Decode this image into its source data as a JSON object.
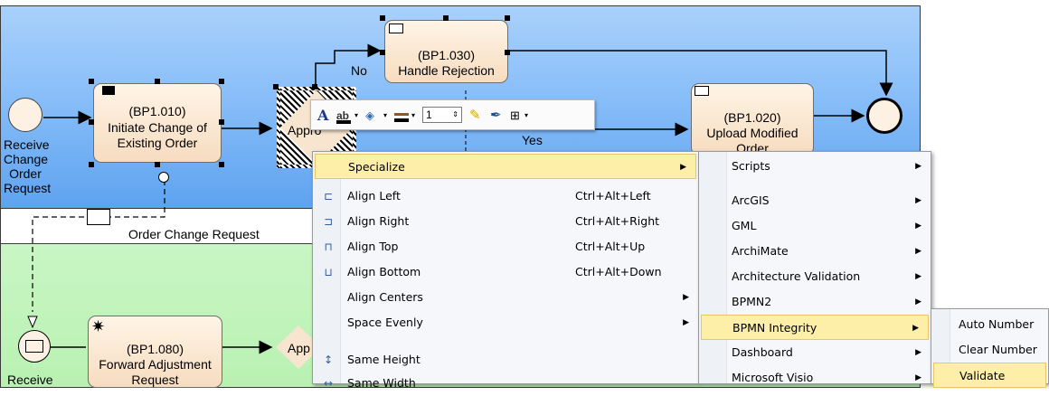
{
  "diagram": {
    "start_event_label": "Receive Change Order Request",
    "start_event_label_lines": [
      "Receive",
      "Change",
      "Order",
      "Request"
    ],
    "task_1010": {
      "id": "(BP1.010)",
      "name_line1": "Initiate Change of",
      "name_line2": "Existing Order"
    },
    "gateway_label": "Approve?",
    "gateway_label_visible": "Appro",
    "task_1030": {
      "id": "(BP1.030)",
      "name": "Handle Rejection"
    },
    "flow_no": "No",
    "flow_yes": "Yes",
    "task_1020": {
      "id": "(BP1.020)",
      "name_line1": "Upload Modified",
      "name_line2": "Order"
    },
    "message_label": "Order Change Request",
    "task_1080": {
      "id": "(BP1.080)",
      "name_line1": "Forward Adjustment",
      "name_line2": "Request"
    },
    "gateway2_label_visible": "App",
    "receive_label": "Receive"
  },
  "toolbar": {
    "font_icon": "font-icon",
    "line_width_value": "1",
    "items": [
      "font-icon",
      "text-color-icon",
      "fill-color-icon",
      "line-color-icon",
      "line-width-field",
      "format-painter-icon",
      "pen-icon",
      "layout-icon"
    ]
  },
  "context_menu": {
    "items": [
      {
        "label": "Specialize",
        "shortcut": "",
        "submenu": true,
        "icon": ""
      },
      {
        "label": "Align Left",
        "shortcut": "Ctrl+Alt+Left",
        "submenu": false,
        "icon": "align-left-icon"
      },
      {
        "label": "Align Right",
        "shortcut": "Ctrl+Alt+Right",
        "submenu": false,
        "icon": "align-right-icon"
      },
      {
        "label": "Align Top",
        "shortcut": "Ctrl+Alt+Up",
        "submenu": false,
        "icon": "align-top-icon"
      },
      {
        "label": "Align Bottom",
        "shortcut": "Ctrl+Alt+Down",
        "submenu": false,
        "icon": "align-bottom-icon"
      },
      {
        "label": "Align Centers",
        "shortcut": "",
        "submenu": true,
        "icon": ""
      },
      {
        "label": "Space Evenly",
        "shortcut": "",
        "submenu": true,
        "icon": ""
      },
      {
        "label": "Same Height",
        "shortcut": "",
        "submenu": false,
        "icon": "same-height-icon"
      },
      {
        "label": "Same Width",
        "shortcut": "",
        "submenu": false,
        "icon": "same-width-icon"
      }
    ]
  },
  "specialize_submenu": {
    "items": [
      "Scripts",
      "ArcGIS",
      "GML",
      "ArchiMate",
      "Architecture Validation",
      "BPMN2",
      "BPMN Integrity",
      "Dashboard",
      "Microsoft Visio"
    ]
  },
  "bpmn_integrity_submenu": {
    "items": [
      "Auto Number",
      "Clear Number",
      "Validate"
    ]
  }
}
